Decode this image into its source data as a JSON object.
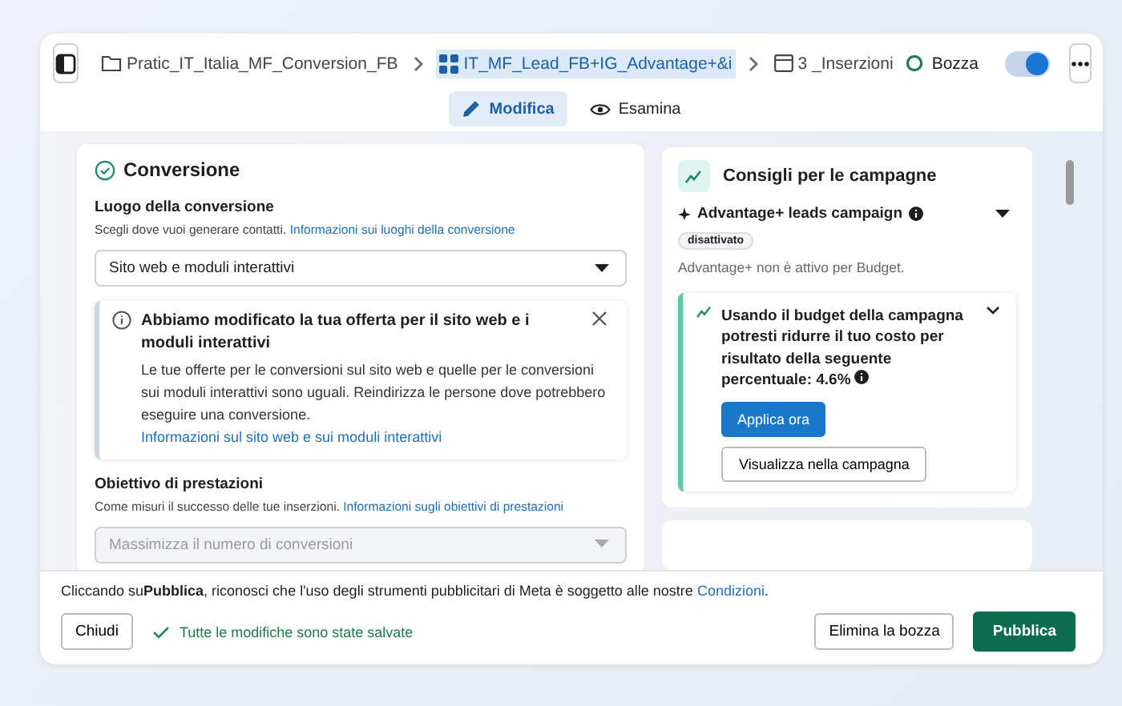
{
  "breadcrumb": [
    {
      "kind": "folder",
      "label": "Pratic_IT_Italia_MF_Conversion_FB",
      "selected": false
    },
    {
      "kind": "adset",
      "label": "IT_MF_Lead_FB+IG_Advantage+&i",
      "selected": true
    },
    {
      "kind": "ad",
      "label": "3 _Inserzioni",
      "selected": false
    }
  ],
  "status": {
    "label": "Bozza",
    "toggle_on": true
  },
  "tabs": [
    {
      "label": "Modifica",
      "selected": true
    },
    {
      "label": "Esamina",
      "selected": false
    }
  ],
  "conversion": {
    "title": "Conversione",
    "location": {
      "label": "Luogo della conversione",
      "help": "Scegli dove vuoi generare contatti.",
      "link": "Informazioni sui luoghi della conversione",
      "value": "Sito web e moduli interattivi",
      "disabled": false
    },
    "notice": {
      "title": "Abbiamo modificato la tua offerta per il sito web e i moduli interattivi",
      "body": "Le tue offerte per le conversioni sul sito web e quelle per le conversioni sui moduli interattivi sono uguali. Reindirizza le persone dove potrebbero eseguire una conversione.",
      "link": "Informazioni sul sito web e sui moduli interattivi"
    },
    "goal": {
      "label": "Obiettivo di prestazioni",
      "help": "Come misuri il successo delle tue inserzioni.",
      "link": "Informazioni sugli obiettivi di prestazioni",
      "value": "Massimizza il numero di conversioni",
      "disabled": true
    }
  },
  "tips": {
    "title": "Consigli per le campagne",
    "feature": "Advantage+ leads campaign",
    "badge": "disattivato",
    "note": "Advantage+ non è attivo per Budget.",
    "suggestion": {
      "text": "Usando il budget della campagna potresti ridurre il tuo costo per risultato della seguente percentuale: 4.6%",
      "primary": "Applica ora",
      "secondary": "Visualizza nella campagna"
    }
  },
  "footer": {
    "terms": "Cliccando su**Pubblica**, riconosci che l'uso degli strumenti pubblicitari di Meta è soggetto alle nostre",
    "terms_link": "Condizioni",
    "terms_end": ".",
    "close": "Chiudi",
    "saved": "Tutte le modifiche sono state salvate",
    "delete": "Elimina la bozza",
    "publish": "Pubblica"
  }
}
